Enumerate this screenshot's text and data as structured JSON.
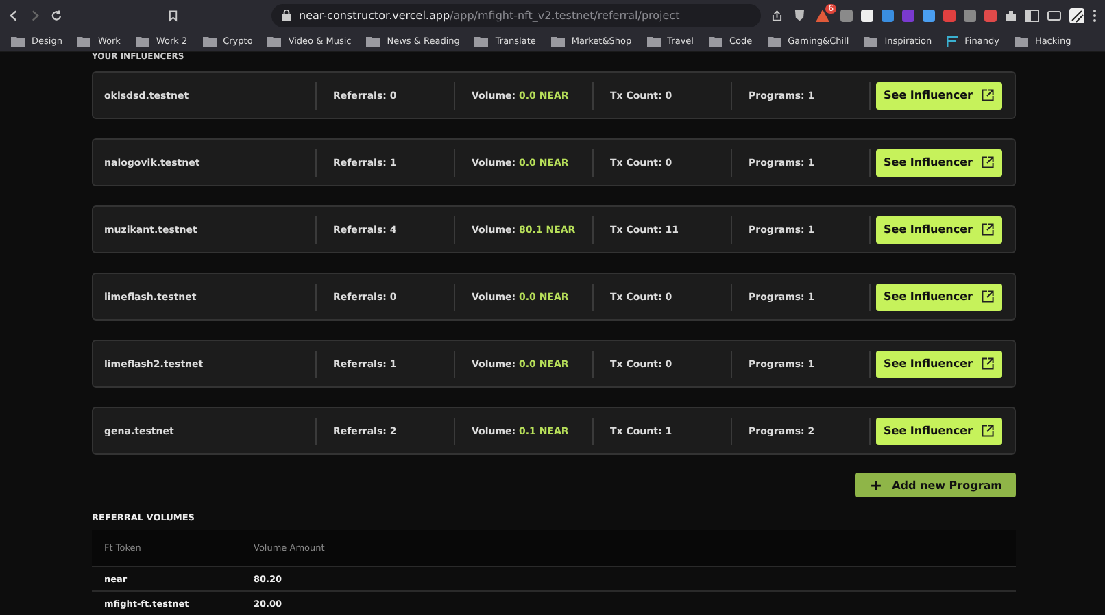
{
  "browser": {
    "url_host": "near-constructor.vercel.app",
    "url_path": "/app/mfight-nft_v2.testnet/referral/project",
    "extension_badge": "6"
  },
  "bookmarks": [
    {
      "label": "Design",
      "kind": "folder"
    },
    {
      "label": "Work",
      "kind": "folder"
    },
    {
      "label": "Work 2",
      "kind": "folder"
    },
    {
      "label": "Crypto",
      "kind": "folder"
    },
    {
      "label": "Video & Music",
      "kind": "folder"
    },
    {
      "label": "News & Reading",
      "kind": "folder"
    },
    {
      "label": "Translate",
      "kind": "folder"
    },
    {
      "label": "Market&Shop",
      "kind": "folder"
    },
    {
      "label": "Travel",
      "kind": "folder"
    },
    {
      "label": "Code",
      "kind": "folder"
    },
    {
      "label": "Gaming&Chill",
      "kind": "folder"
    },
    {
      "label": "Inspiration",
      "kind": "folder"
    },
    {
      "label": "Finandy",
      "kind": "site"
    },
    {
      "label": "Hacking",
      "kind": "folder"
    }
  ],
  "influencers_heading": "YOUR INFLUENCERS",
  "influencers": [
    {
      "name": "oklsdsd.testnet",
      "referrals": "Referrals: 0",
      "volume_label": "Volume:",
      "volume": "0.0 NEAR",
      "tx_count": "Tx Count: 0",
      "programs": "Programs: 1",
      "button": "See Influencer"
    },
    {
      "name": "nalogovik.testnet",
      "referrals": "Referrals: 1",
      "volume_label": "Volume:",
      "volume": "0.0 NEAR",
      "tx_count": "Tx Count: 0",
      "programs": "Programs: 1",
      "button": "See Influencer"
    },
    {
      "name": "muzikant.testnet",
      "referrals": "Referrals: 4",
      "volume_label": "Volume:",
      "volume": "80.1 NEAR",
      "tx_count": "Tx Count: 11",
      "programs": "Programs: 1",
      "button": "See Influencer"
    },
    {
      "name": "limeflash.testnet",
      "referrals": "Referrals: 0",
      "volume_label": "Volume:",
      "volume": "0.0 NEAR",
      "tx_count": "Tx Count: 0",
      "programs": "Programs: 1",
      "button": "See Influencer"
    },
    {
      "name": "limeflash2.testnet",
      "referrals": "Referrals: 1",
      "volume_label": "Volume:",
      "volume": "0.0 NEAR",
      "tx_count": "Tx Count: 0",
      "programs": "Programs: 1",
      "button": "See Influencer"
    },
    {
      "name": "gena.testnet",
      "referrals": "Referrals: 2",
      "volume_label": "Volume:",
      "volume": "0.1 NEAR",
      "tx_count": "Tx Count: 1",
      "programs": "Programs: 2",
      "button": "See Influencer"
    }
  ],
  "add_button": {
    "icon": "+",
    "label": "Add new Program"
  },
  "referral_volumes": {
    "title": "REFERRAL VOLUMES",
    "columns": [
      "Ft Token",
      "Volume Amount"
    ],
    "rows": [
      [
        "near",
        "80.20"
      ],
      [
        "mfight-ft.testnet",
        "20.00"
      ]
    ]
  }
}
